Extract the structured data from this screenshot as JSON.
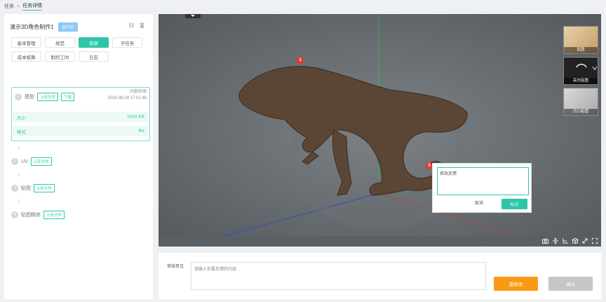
{
  "breadcrumb": {
    "root": "任务",
    "separator": ">",
    "current": "任务详情"
  },
  "task": {
    "title": "演示3D角色制作1",
    "status": "进行中"
  },
  "tabs": [
    {
      "label": "基本管理",
      "active": false
    },
    {
      "label": "规范",
      "active": false
    },
    {
      "label": "资源",
      "active": true
    },
    {
      "label": "子任务",
      "active": false
    },
    {
      "label": "成本核算",
      "active": false
    },
    {
      "label": "制作工时",
      "active": false
    },
    {
      "label": "日志",
      "active": false
    }
  ],
  "steps": [
    {
      "num": "1",
      "label": "模型",
      "upload": "上传文件",
      "download": "下载",
      "review": "内部待审",
      "time": "2019-08-29 17:01:46",
      "details": [
        {
          "key": "大小",
          "value": "2420 KB"
        },
        {
          "key": "格式",
          "value": "fbx"
        }
      ]
    },
    {
      "num": "2",
      "label": "UV",
      "upload": "上传文件"
    },
    {
      "num": "3",
      "label": "贴图",
      "upload": "上传文件"
    },
    {
      "num": "4",
      "label": "贴图精修",
      "upload": "上传文件"
    }
  ],
  "viewer": {
    "thumbnails": [
      "贴图",
      "高光贴图",
      "凹凸贴图"
    ],
    "markers": [
      "1",
      "2"
    ],
    "tools": [
      "camera-icon",
      "move-icon",
      "axis-icon",
      "cube-icon",
      "expand-icon",
      "fullscreen-icon"
    ]
  },
  "feedback_popup": {
    "placeholder": "修改反馈",
    "cancel": "取消",
    "confirm": "标记"
  },
  "review": {
    "label": "审核意见",
    "placeholder": "请输入你要反馈的内容",
    "modify": "需修改",
    "pass": "通过"
  },
  "colors": {
    "accent": "#2fc5a8",
    "status": "#8dc8f5",
    "marker": "#e8382f",
    "modify": "#fa9a14",
    "pass_disabled": "#c6c6c6"
  }
}
